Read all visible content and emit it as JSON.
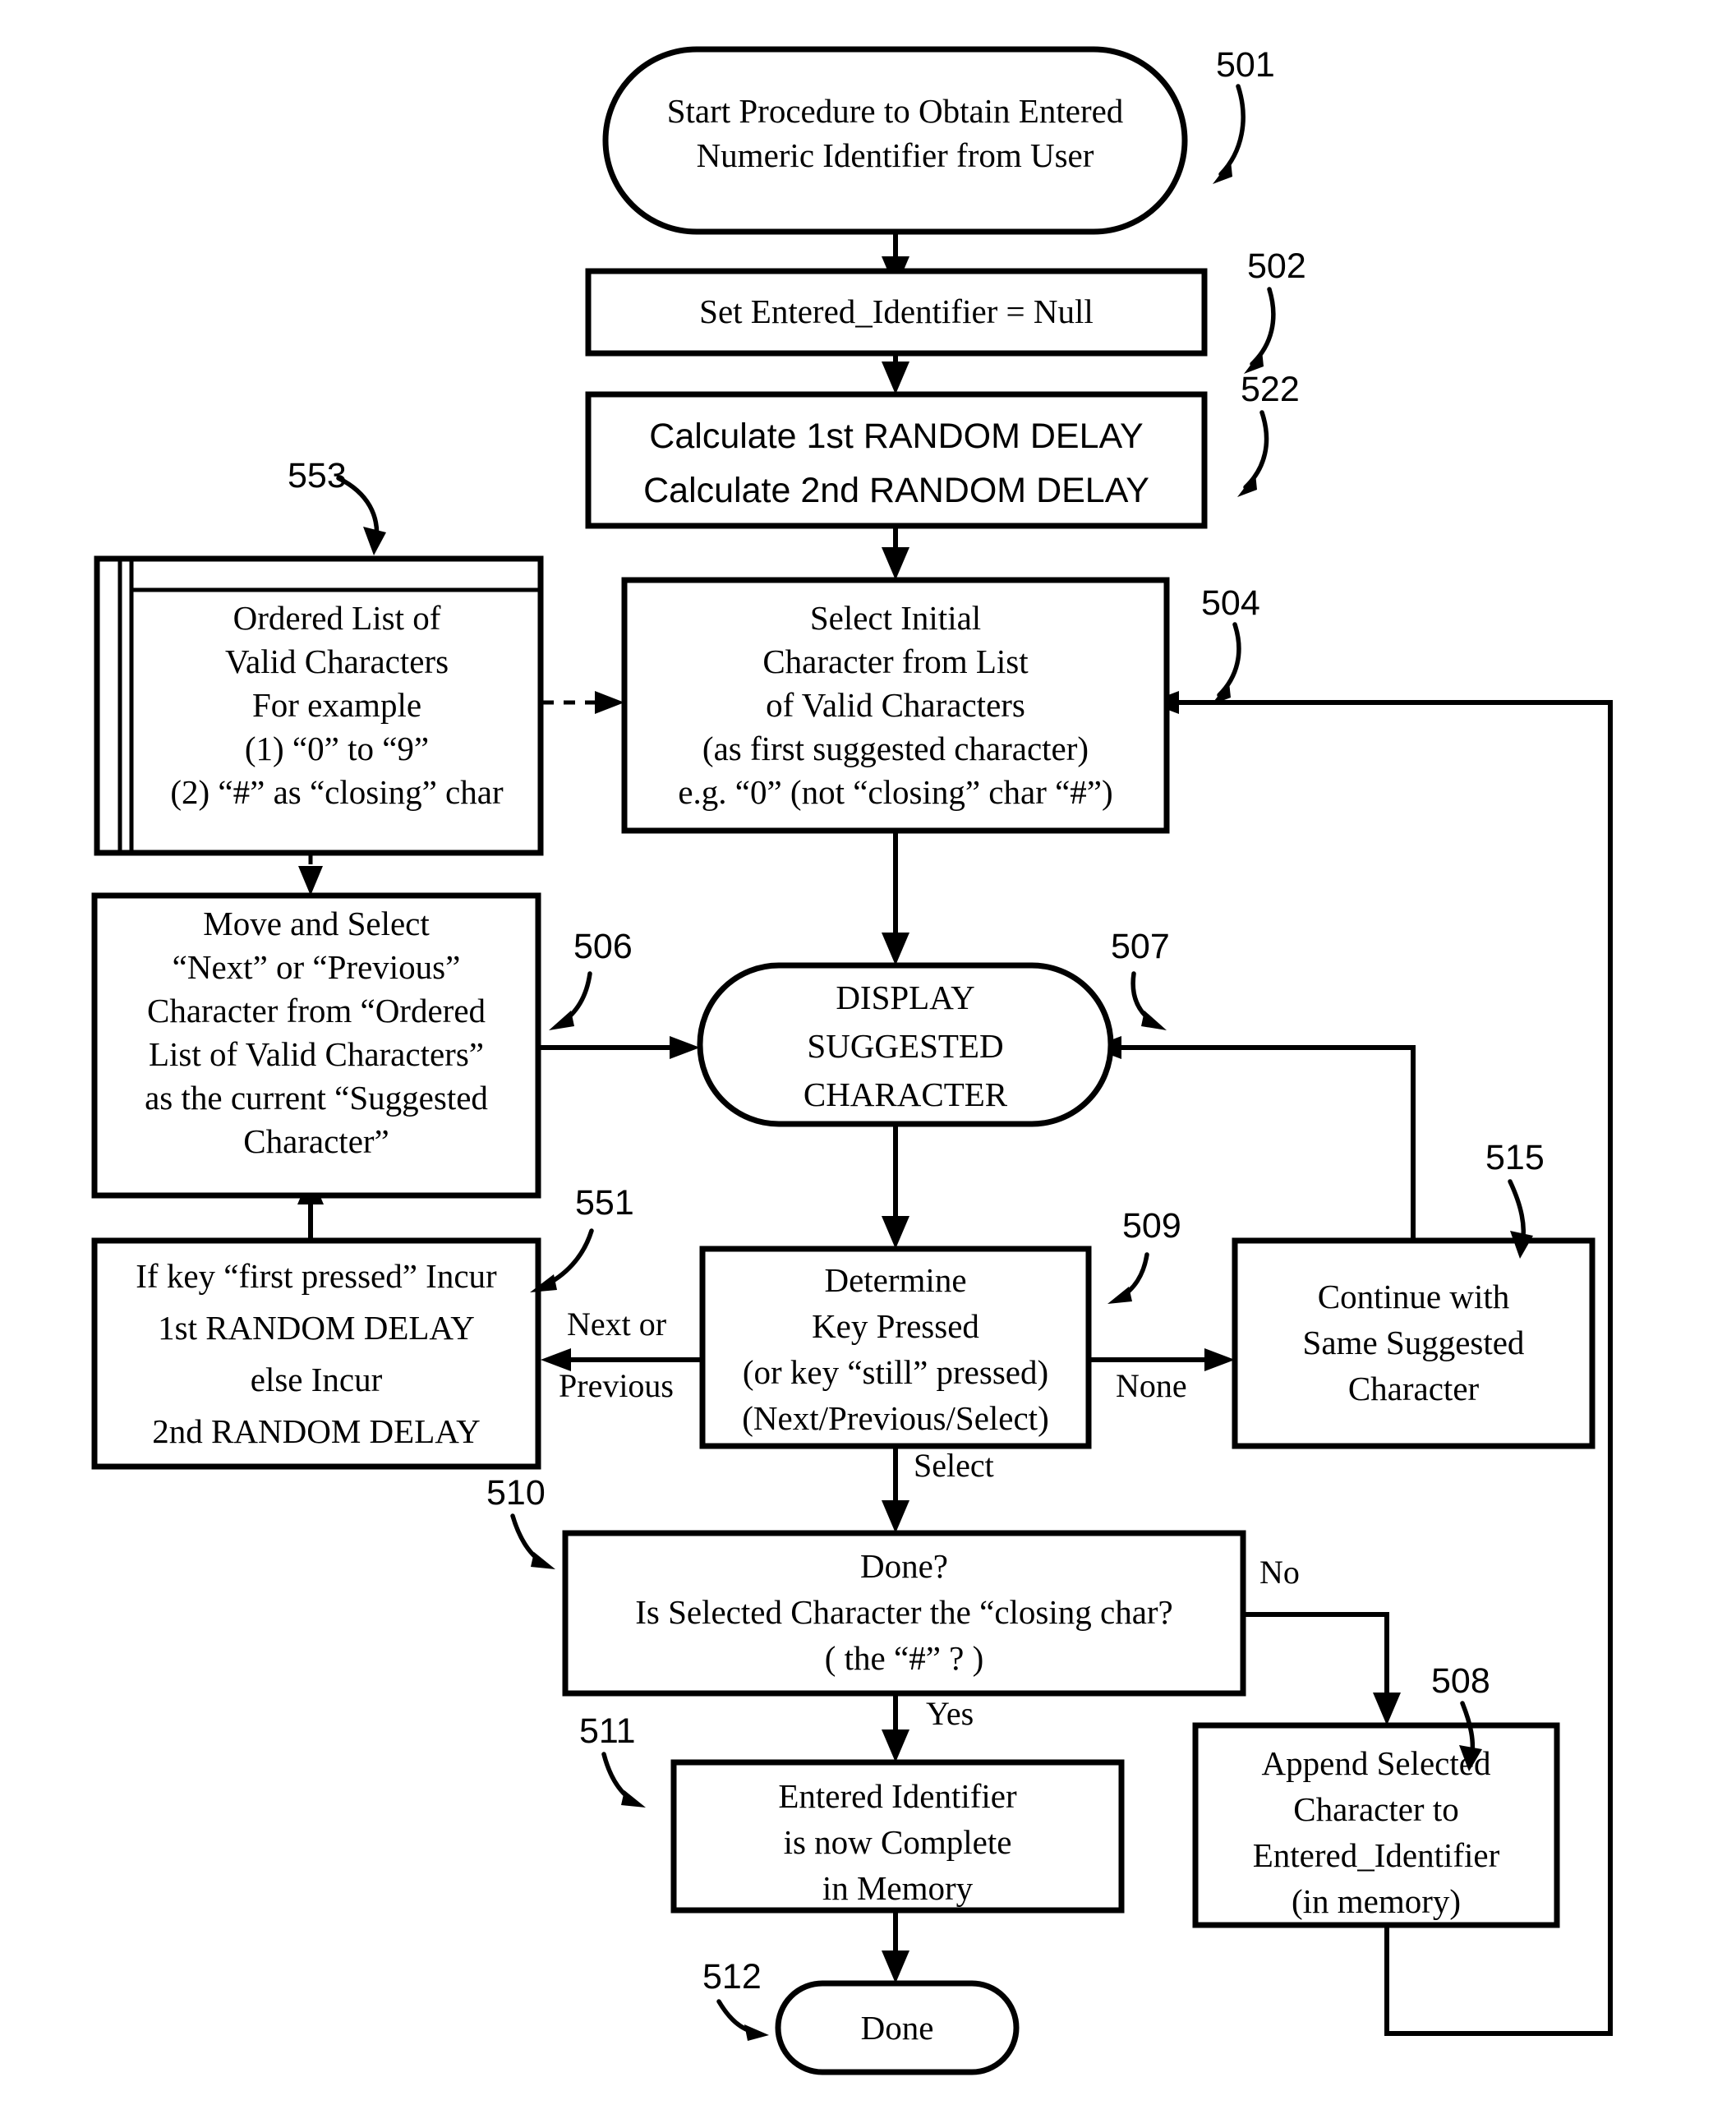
{
  "figure": {
    "type": "flowchart",
    "title": "Procedure to Obtain Entered Numeric Identifier from User"
  },
  "nodes": {
    "start": {
      "ref": "501",
      "shape": "stadium",
      "lines": [
        "Start Procedure to Obtain Entered",
        "Numeric Identifier from User"
      ]
    },
    "set_null": {
      "ref": "502",
      "shape": "rect",
      "lines": [
        "Set Entered_Identifier = Null"
      ]
    },
    "calc_delays": {
      "ref": "522",
      "shape": "rect",
      "lines": [
        "Calculate 1st RANDOM DELAY",
        "Calculate 2nd RANDOM DELAY"
      ]
    },
    "ordered_list": {
      "ref": "553",
      "shape": "storage",
      "lines": [
        "Ordered List of",
        "Valid Characters",
        "For example",
        "(1)  “0” to “9”",
        "(2) “#” as “closing” char"
      ]
    },
    "select_initial": {
      "ref": "504",
      "shape": "rect",
      "lines": [
        "Select Initial",
        "Character from List",
        "of Valid Characters",
        "(as first suggested character)",
        "e.g. “0”  (not “closing” char “#”)"
      ]
    },
    "move_select": {
      "ref": "506",
      "shape": "rect",
      "lines": [
        "Move and Select",
        "“Next” or “Previous”",
        "Character from “Ordered",
        "List of Valid Characters”",
        "as the current “Suggested",
        "Character”"
      ]
    },
    "display": {
      "ref": "507",
      "shape": "stadium",
      "lines": [
        "DISPLAY",
        "SUGGESTED",
        "CHARACTER"
      ]
    },
    "random_delay": {
      "ref": "551",
      "shape": "rect",
      "lines": [
        "If key “first pressed” Incur",
        "1st RANDOM DELAY",
        "else Incur",
        "2nd RANDOM DELAY"
      ]
    },
    "determine_key": {
      "ref": "509",
      "shape": "rect",
      "lines": [
        "Determine",
        "Key Pressed",
        "(or key “still” pressed)",
        "(Next/Previous/Select)"
      ]
    },
    "continue_same": {
      "ref": "515",
      "shape": "rect",
      "lines": [
        "Continue with",
        "Same Suggested",
        "Character"
      ]
    },
    "done_check": {
      "ref": "510",
      "shape": "rect",
      "lines": [
        "Done?",
        "Is Selected Character the “closing char?",
        "( the  “#” ? )"
      ]
    },
    "complete": {
      "ref": "511",
      "shape": "rect",
      "lines": [
        "Entered Identifier",
        "is now Complete",
        "in  Memory"
      ]
    },
    "append": {
      "ref": "508",
      "shape": "rect",
      "lines": [
        "Append Selected",
        "Character to",
        "Entered_Identifier",
        "(in memory)"
      ]
    },
    "done_end": {
      "ref": "512",
      "shape": "stadium",
      "lines": [
        "Done"
      ]
    }
  },
  "edge_labels": {
    "next_or_previous_1": "Next or",
    "next_or_previous_2": "Previous",
    "none": "None",
    "select": "Select",
    "yes": "Yes",
    "no": "No"
  },
  "colors": {
    "stroke": "#000000",
    "fill": "#ffffff",
    "text": "#000000"
  }
}
